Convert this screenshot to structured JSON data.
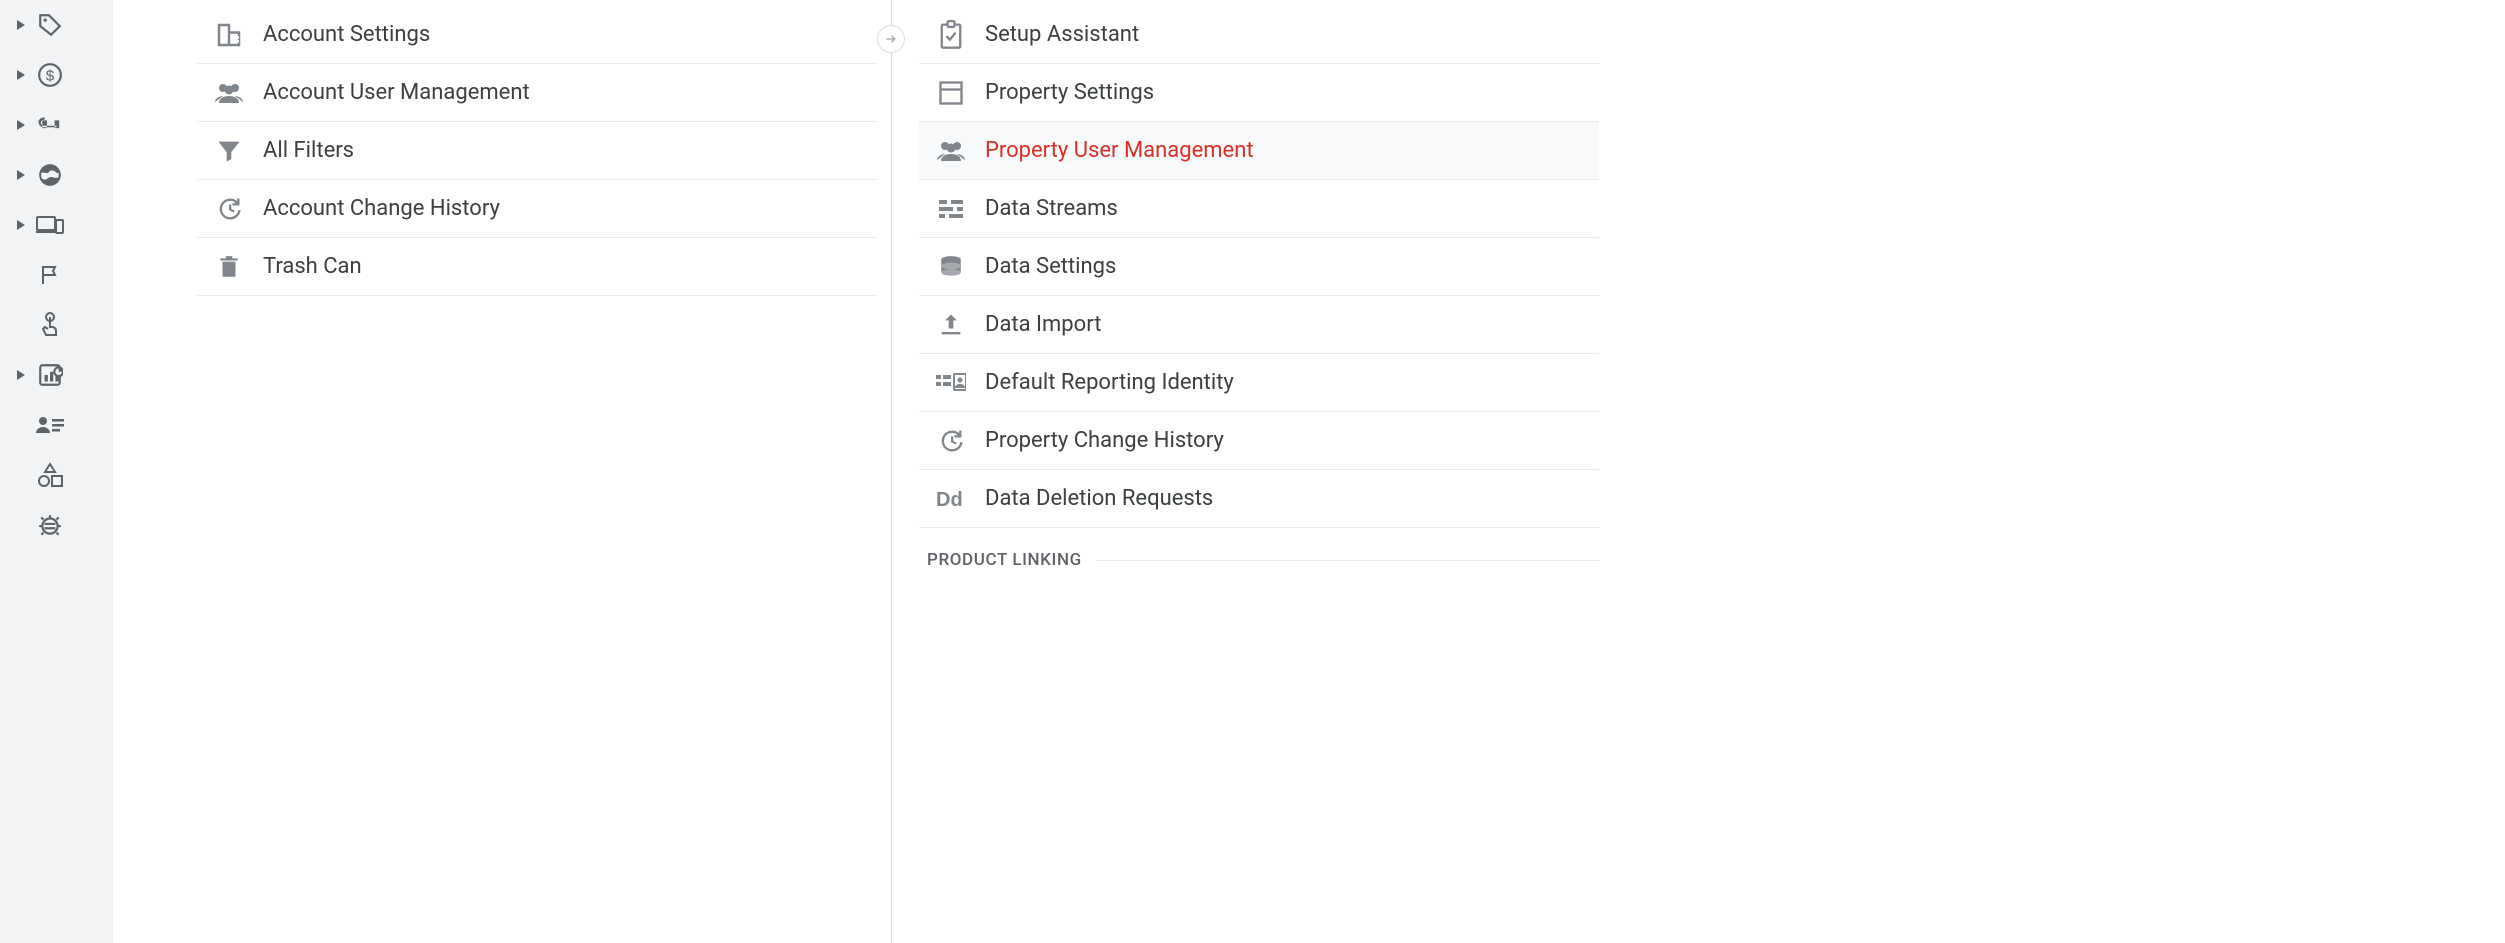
{
  "rail": {
    "items": [
      {
        "name": "tag",
        "caret": true
      },
      {
        "name": "dollar",
        "caret": true
      },
      {
        "name": "magnet",
        "caret": true
      },
      {
        "name": "globe",
        "caret": true
      },
      {
        "name": "devices",
        "caret": true
      },
      {
        "name": "flag",
        "caret": false
      },
      {
        "name": "touch",
        "caret": false
      },
      {
        "name": "chart",
        "caret": true
      },
      {
        "name": "userlist",
        "caret": false
      },
      {
        "name": "shapes",
        "caret": false
      },
      {
        "name": "bug",
        "caret": false
      }
    ]
  },
  "accountColumn": {
    "items": [
      {
        "icon": "building",
        "label": "Account Settings"
      },
      {
        "icon": "people",
        "label": "Account User Management"
      },
      {
        "icon": "filter",
        "label": "All Filters"
      },
      {
        "icon": "history",
        "label": "Account Change History"
      },
      {
        "icon": "trash",
        "label": "Trash Can"
      }
    ]
  },
  "propertyColumn": {
    "items": [
      {
        "icon": "assist",
        "label": "Setup Assistant",
        "active": false
      },
      {
        "icon": "window",
        "label": "Property Settings",
        "active": false
      },
      {
        "icon": "people",
        "label": "Property User Management",
        "active": true
      },
      {
        "icon": "streams",
        "label": "Data Streams",
        "active": false
      },
      {
        "icon": "database",
        "label": "Data Settings",
        "active": false
      },
      {
        "icon": "upload",
        "label": "Data Import",
        "active": false
      },
      {
        "icon": "identity",
        "label": "Default Reporting Identity",
        "active": false
      },
      {
        "icon": "history",
        "label": "Property Change History",
        "active": false
      },
      {
        "icon": "dd",
        "label": "Data Deletion Requests",
        "active": false
      }
    ],
    "sectionHeader": "PRODUCT LINKING"
  }
}
